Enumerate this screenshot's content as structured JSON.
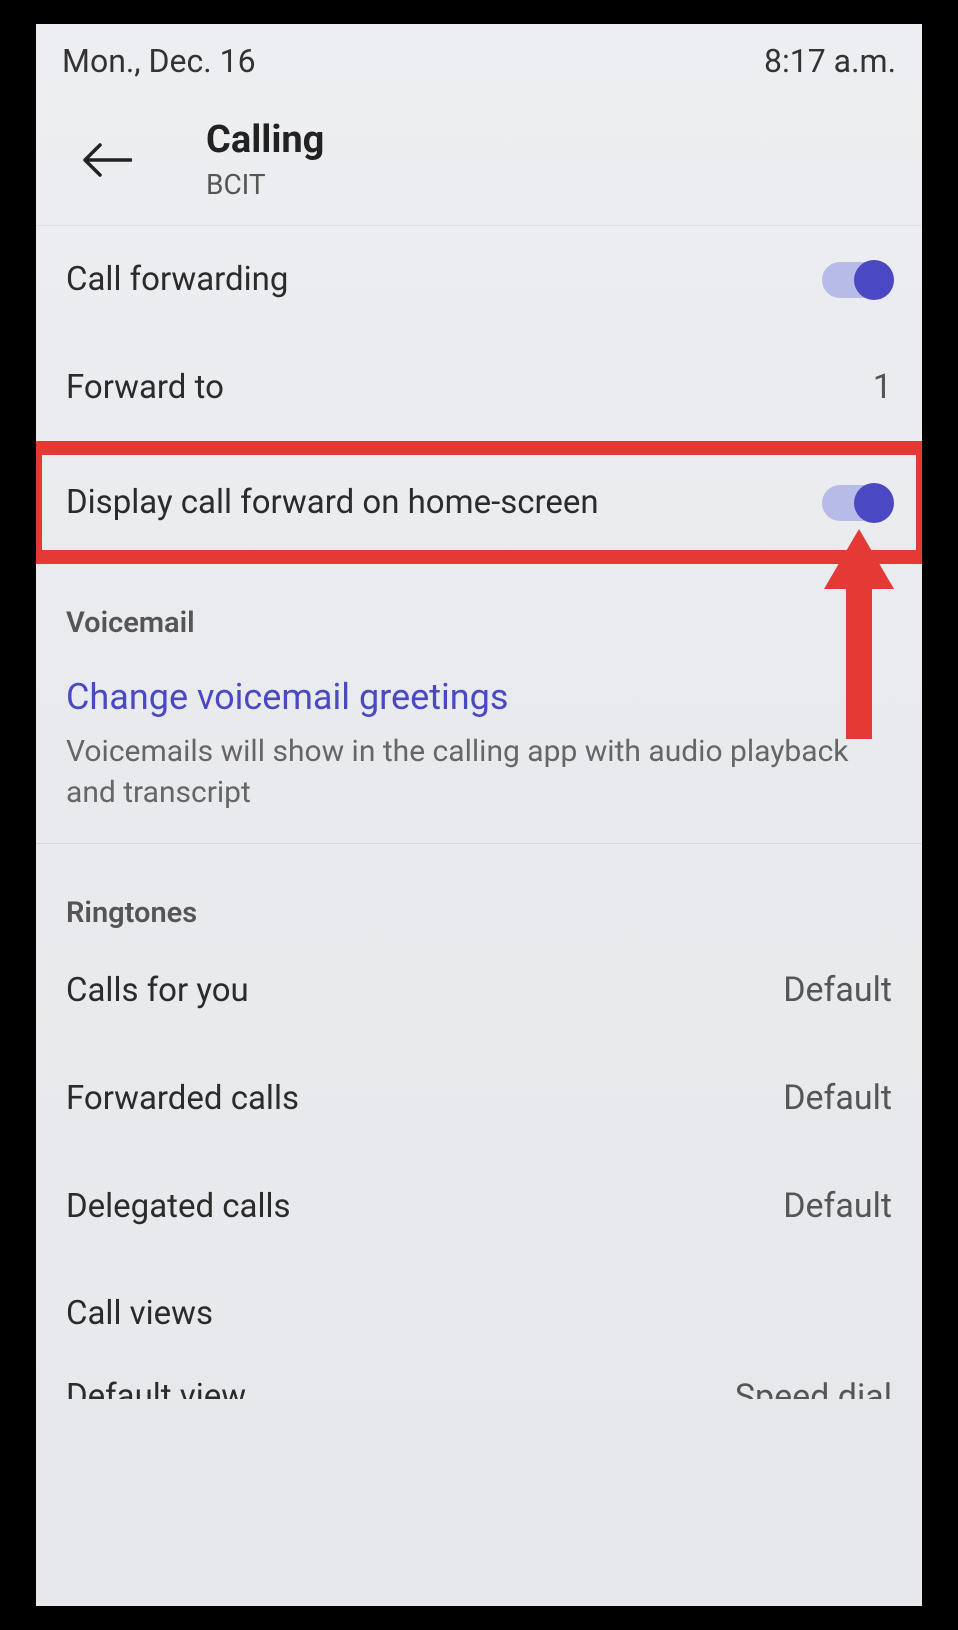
{
  "status_bar": {
    "date": "Mon., Dec. 16",
    "time": "8:17 a.m."
  },
  "header": {
    "title": "Calling",
    "subtitle": "BCIT"
  },
  "call_forwarding": {
    "label": "Call forwarding",
    "enabled": true
  },
  "forward_to": {
    "label": "Forward to",
    "value": "1"
  },
  "display_home": {
    "label": "Display call forward on home-screen",
    "enabled": true
  },
  "voicemail": {
    "section": "Voicemail",
    "link": "Change voicemail greetings",
    "desc": "Voicemails will show in the calling app with audio playback and transcript"
  },
  "ringtones": {
    "section": "Ringtones",
    "items": [
      {
        "label": "Calls for you",
        "value": "Default"
      },
      {
        "label": "Forwarded calls",
        "value": "Default"
      },
      {
        "label": "Delegated calls",
        "value": "Default"
      }
    ]
  },
  "call_views": {
    "label": "Call views"
  },
  "default_view": {
    "label": "Default view",
    "value": "Speed dial"
  }
}
